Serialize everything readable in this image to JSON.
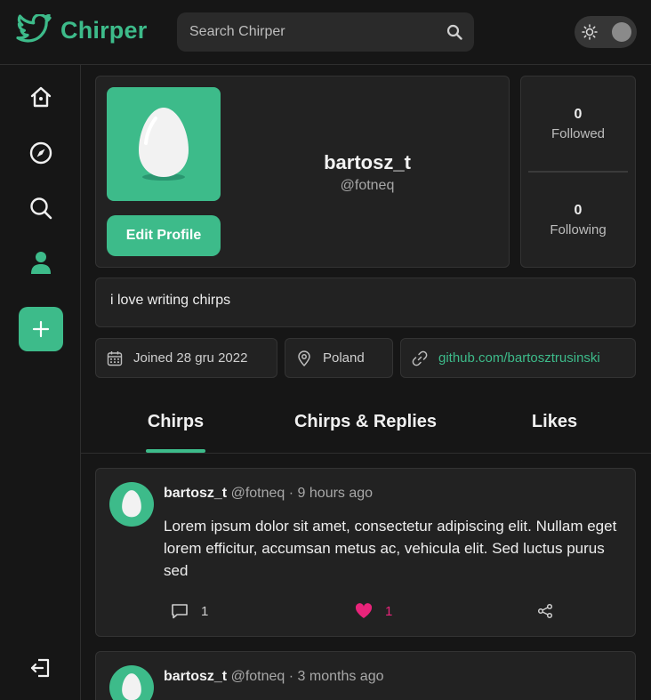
{
  "app": {
    "name": "Chirper",
    "accent": "#3dbb8a",
    "like_color": "#e8247a"
  },
  "search": {
    "placeholder": "Search Chirper"
  },
  "sidebar": {
    "items": [
      {
        "icon": "home-icon"
      },
      {
        "icon": "explore-compass-icon"
      },
      {
        "icon": "search-icon"
      },
      {
        "icon": "profile-icon",
        "active": true
      }
    ]
  },
  "profile": {
    "name": "bartosz_t",
    "handle": "@fotneq",
    "edit_label": "Edit Profile",
    "bio": "i love writing chirps",
    "stats": [
      {
        "value": "0",
        "label": "Followed"
      },
      {
        "value": "0",
        "label": "Following"
      }
    ],
    "joined": "Joined 28 gru 2022",
    "location": "Poland",
    "link": "github.com/bartosztrusinski"
  },
  "tabs": [
    {
      "label": "Chirps",
      "active": true
    },
    {
      "label": "Chirps & Replies",
      "active": false
    },
    {
      "label": "Likes",
      "active": false
    }
  ],
  "chirps": [
    {
      "username": "bartosz_t",
      "handle": "@fotneq",
      "separator": "·",
      "time": "9 hours ago",
      "text": "Lorem ipsum dolor sit amet, consectetur adipiscing elit. Nullam eget lorem efficitur, accumsan metus ac, vehicula elit. Sed luctus purus sed",
      "replies": "1",
      "likes": "1"
    },
    {
      "username": "bartosz_t",
      "handle": "@fotneq",
      "separator": "·",
      "time": "3 months ago"
    }
  ]
}
